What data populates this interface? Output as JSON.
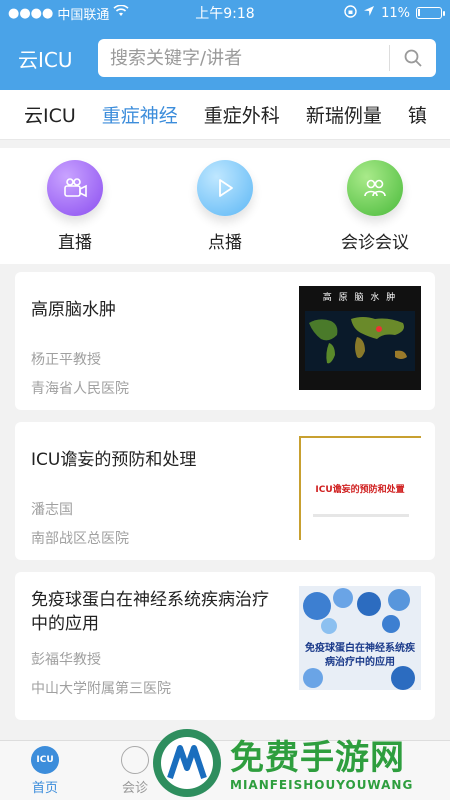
{
  "status": {
    "carrier": "中国联通",
    "time": "上午9:18",
    "battery": "11%",
    "battery_level": 0.11
  },
  "header": {
    "title": "云ICU",
    "search_placeholder": "搜索关键字/讲者"
  },
  "tabs": [
    "云ICU",
    "重症神经",
    "重症外科",
    "新瑞例量",
    "镇"
  ],
  "active_tab": 1,
  "quick_actions": [
    {
      "label": "直播",
      "icon": "video-camera-icon"
    },
    {
      "label": "点播",
      "icon": "play-icon"
    },
    {
      "label": "会诊会议",
      "icon": "people-icon"
    }
  ],
  "cards": [
    {
      "title": "高原脑水肿",
      "speaker": "杨正平教授",
      "hospital": "青海省人民医院",
      "thumb_title": "高 原 脑 水 肿"
    },
    {
      "title": "ICU谵妄的预防和处理",
      "speaker": "潘志国",
      "hospital": "南部战区总医院",
      "thumb_title": "ICU谵妄的预防和处置"
    },
    {
      "title": "免疫球蛋白在神经系统疾病治疗中的应用",
      "speaker": "彭福华教授",
      "hospital": "中山大学附属第三医院",
      "thumb_title": "免疫球蛋白在神经系统疾病治疗中的应用"
    }
  ],
  "bottom_nav": [
    {
      "label": "首页",
      "active": true
    },
    {
      "label": "会诊"
    }
  ],
  "watermark": {
    "main": "免费手游网",
    "sub": "MIANFEISHOUYOUWANG"
  }
}
